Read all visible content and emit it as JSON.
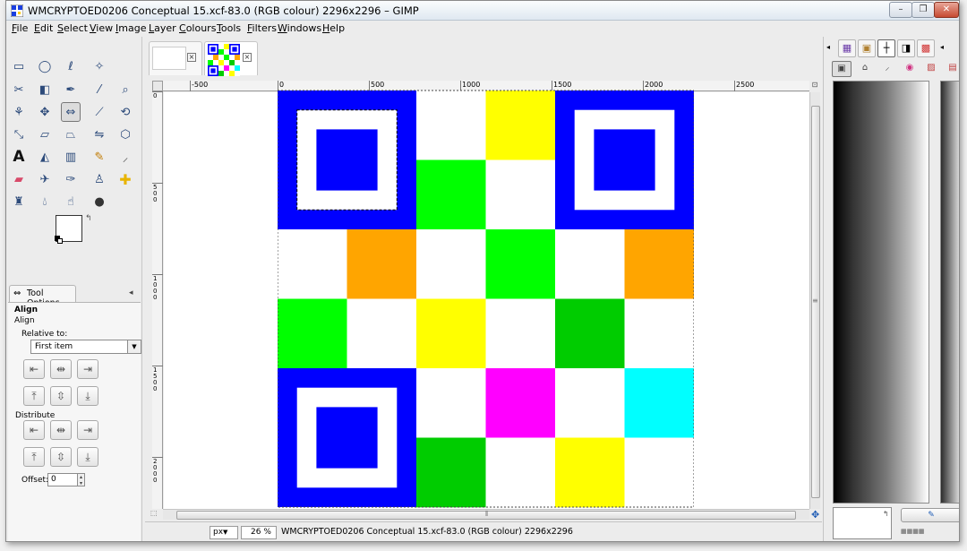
{
  "window": {
    "title": "WMCRYPTOED0206 Conceptual 15.xcf-83.0 (RGB colour) 2296x2296 – GIMP",
    "controls": {
      "minimize": "–",
      "maximize": "❐",
      "close": "✕"
    }
  },
  "menu": [
    "File",
    "Edit",
    "Select",
    "View",
    "Image",
    "Layer",
    "Colours",
    "Tools",
    "Filters",
    "Windows",
    "Help"
  ],
  "toolbox": {
    "tool_options_tab": "Tool Options",
    "options": {
      "title": "Align",
      "subtitle": "Align",
      "relative_label": "Relative to:",
      "relative_value": "First item",
      "distribute_label": "Distribute",
      "offset_label": "Offset:",
      "offset_value": "0"
    }
  },
  "ruler": {
    "top_labels": [
      "-500",
      "0",
      "500",
      "1000",
      "1500",
      "2000",
      "2500"
    ],
    "left_labels": [
      "0",
      "500",
      "1000",
      "1500",
      "2000"
    ]
  },
  "status": {
    "unit": "px",
    "zoom": "26 %",
    "text": "WMCRYPTOED0206 Conceptual 15.xcf-83.0 (RGB colour) 2296x2296"
  },
  "colors": {
    "blue": "#0000ff",
    "white": "#ffffff",
    "yellow": "#ffff00",
    "lime": "#00ff00",
    "green": "#00cc00",
    "orange": "#ffa500",
    "magenta": "#ff00ff",
    "cyan": "#00ffff"
  },
  "canvas": {
    "rows": [
      [
        "Q",
        "Q",
        "white",
        "yellow",
        "Q",
        "Q"
      ],
      [
        "Q",
        "Q",
        "lime",
        "white",
        "Q",
        "Q"
      ],
      [
        "white",
        "orange",
        "white",
        "lime",
        "white",
        "orange"
      ],
      [
        "lime",
        "white",
        "yellow",
        "white",
        "green",
        "white"
      ],
      [
        "Q",
        "Q",
        "white",
        "magenta",
        "white",
        "cyan"
      ],
      [
        "Q",
        "Q",
        "green",
        "white",
        "yellow",
        "white"
      ]
    ],
    "finder_positions": [
      "top-left",
      "top-right",
      "bottom-left"
    ]
  }
}
